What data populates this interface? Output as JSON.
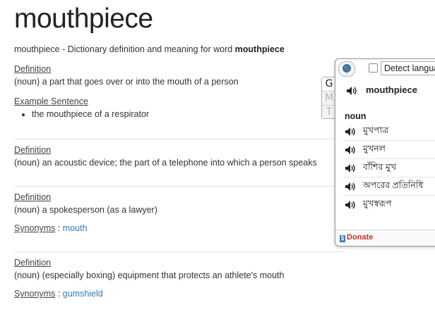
{
  "word": "mouthpiece",
  "intro": {
    "prefix": "mouthpiece - Dictionary definition and meaning for word ",
    "bold": "mouthpiece"
  },
  "entries": [
    {
      "label": "Definition",
      "text": "(noun) a part that goes over or into the mouth of a person",
      "example_label": "Example Sentence",
      "examples": [
        "the mouthpiece of a respirator"
      ]
    },
    {
      "label": "Definition",
      "text": "(noun) an acoustic device; the part of a telephone into which a person speaks"
    },
    {
      "label": "Definition",
      "text": "(noun) a spokesperson (as a lawyer)",
      "synonyms_label": "Synonyms",
      "synonyms_sep": " : ",
      "synonyms": "mouth"
    },
    {
      "label": "Definition",
      "text": "(noun) (especially boxing) equipment that protects an athlete's mouth",
      "synonyms_label": "Synonyms",
      "synonyms_sep": " : ",
      "synonyms": "gumshield"
    }
  ],
  "popup": {
    "detect_label": "Detect language",
    "word": "mouthpiece",
    "pos": "noun",
    "translations": [
      "মুখপাত্র",
      "মুখনল",
      "বাঁশির মুখ",
      "অপরের প্রতিনিধি",
      "মুখস্বরূপ"
    ],
    "donate": "Donate",
    "donate_icon": "$"
  },
  "gmt_tabs": [
    "G",
    "M",
    "T"
  ],
  "colors": {
    "link": "#337ab7",
    "donate": "#c9302c"
  },
  "icons": {
    "speaker": "speaker-icon",
    "globe": "globe-icon"
  }
}
